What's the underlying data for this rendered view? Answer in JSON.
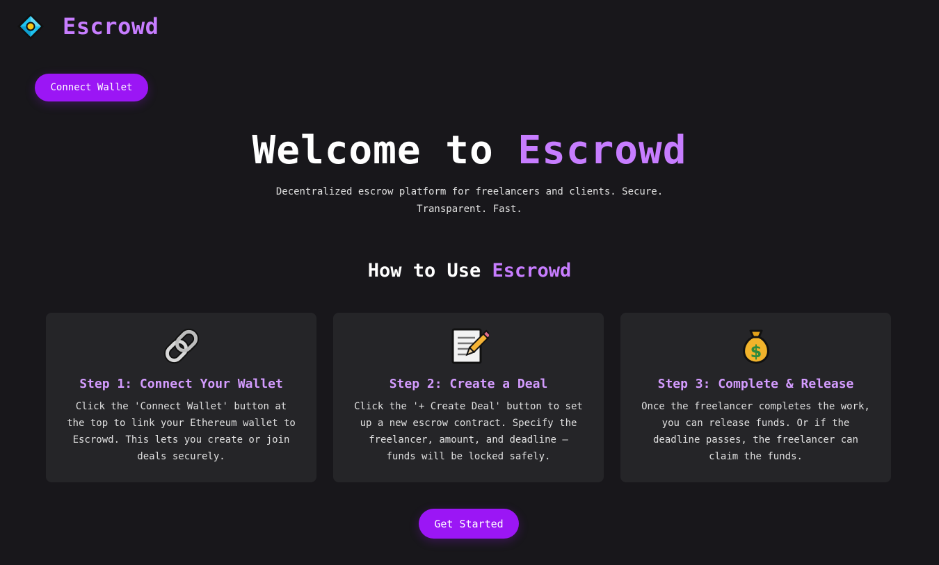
{
  "header": {
    "brand": "Escrowd",
    "logo_icon": "diamond-logo-icon"
  },
  "connect_button": "Connect Wallet",
  "hero": {
    "title_prefix": "Welcome to ",
    "title_accent": "Escrowd",
    "subtitle": "Decentralized escrow platform for freelancers and clients. Secure. Transparent. Fast."
  },
  "how_to": {
    "prefix": "How to Use ",
    "accent": "Escrowd"
  },
  "steps": [
    {
      "icon": "chain-link-icon",
      "title": "Step 1: Connect Your Wallet",
      "desc": "Click the 'Connect Wallet' button at the top to link your Ethereum wallet to Escrowd. This lets you create or join deals securely."
    },
    {
      "icon": "memo-icon",
      "title": "Step 2: Create a Deal",
      "desc": "Click the '+ Create Deal' button to set up a new escrow contract. Specify the freelancer, amount, and deadline — funds will be locked safely."
    },
    {
      "icon": "money-bag-icon",
      "title": "Step 3: Complete & Release",
      "desc": "Once the freelancer completes the work, you can release funds. Or if the deadline passes, the freelancer can claim the funds."
    }
  ],
  "get_started_button": "Get Started",
  "colors": {
    "background": "#18171b",
    "accent": "#c77dff",
    "button": "#9b16f5",
    "card": "#252528"
  }
}
